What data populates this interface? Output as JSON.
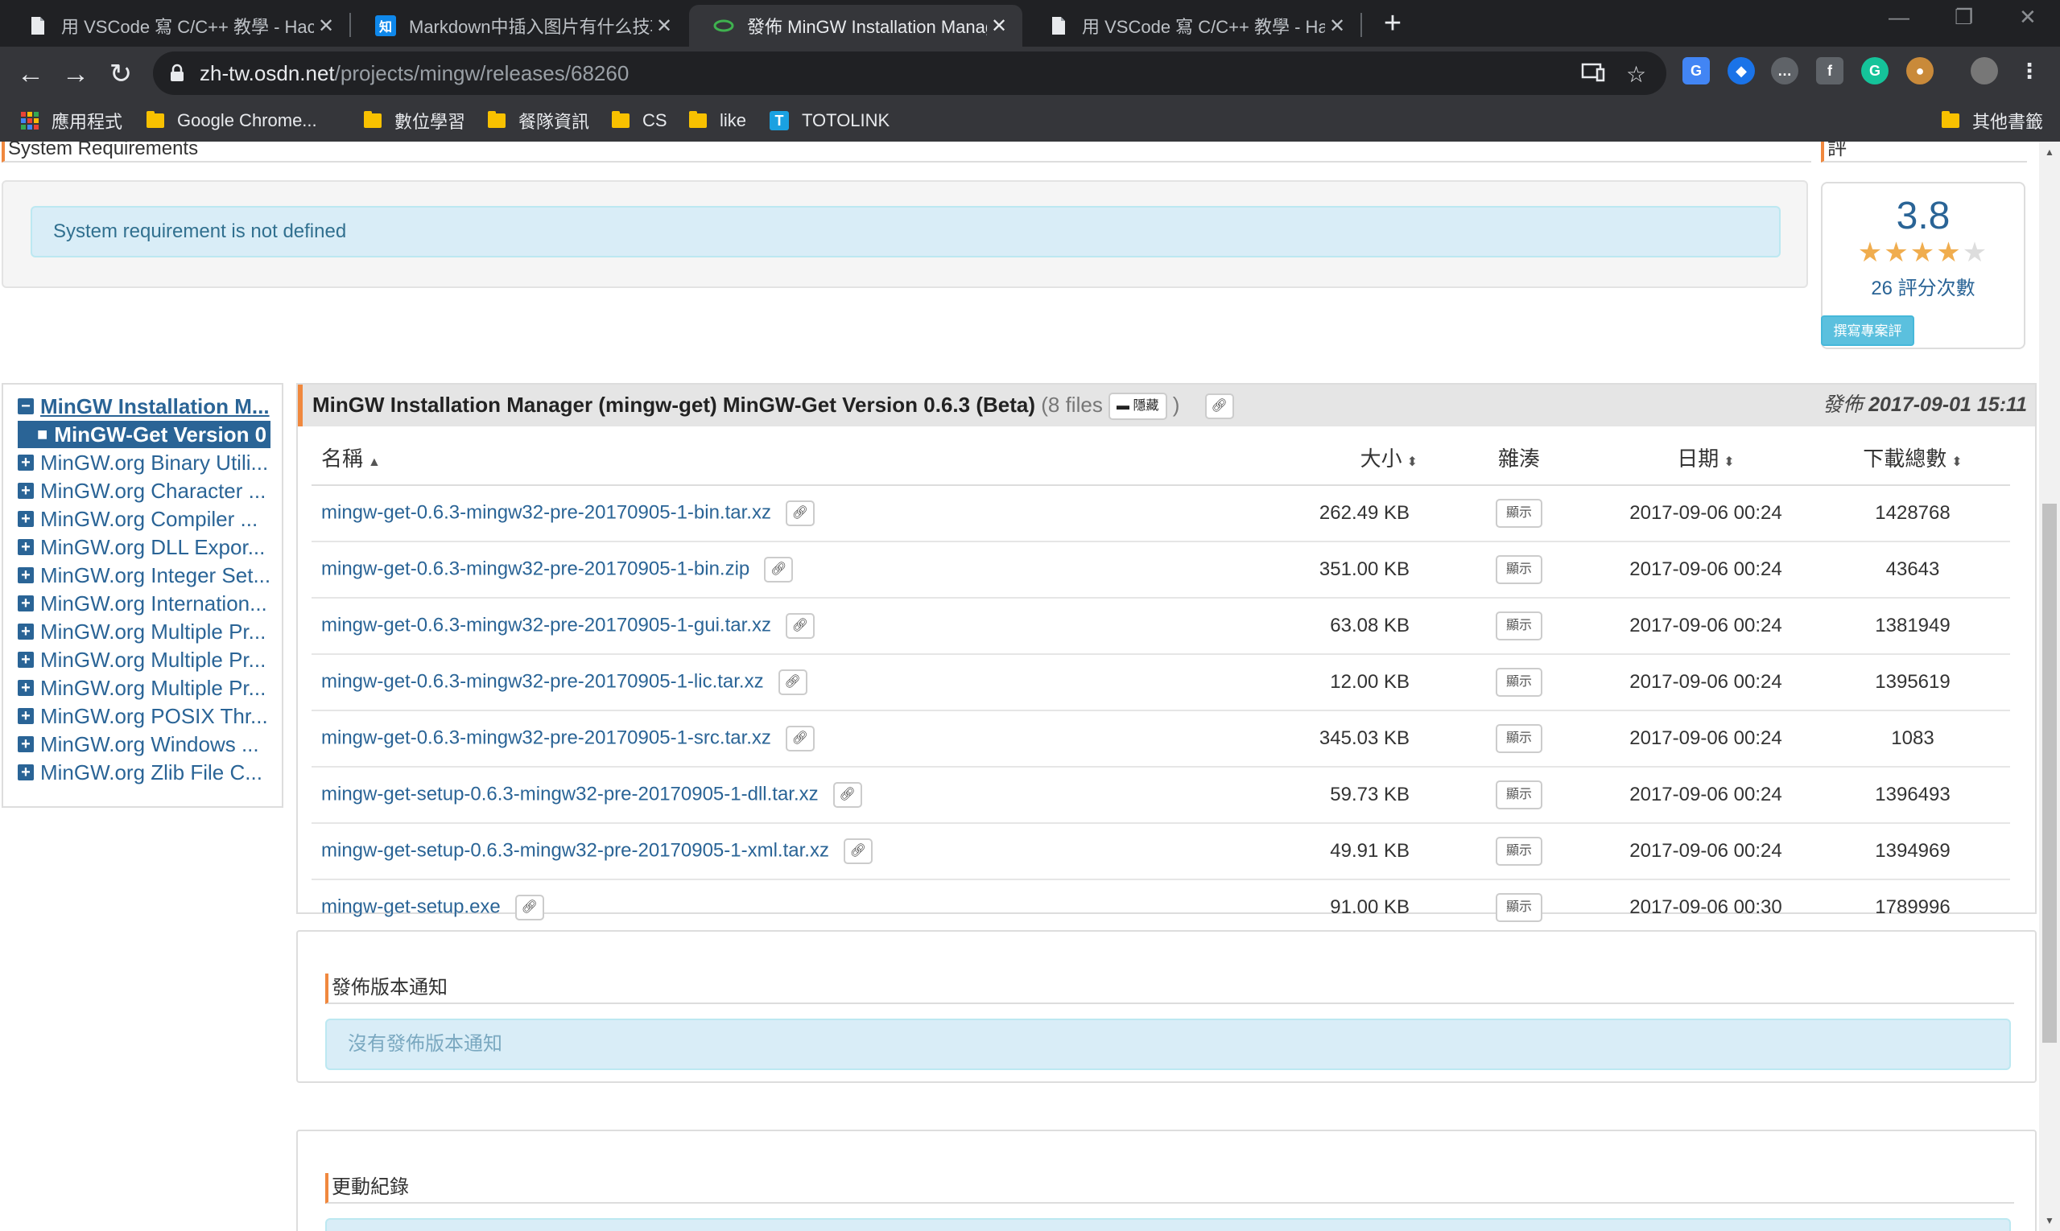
{
  "browser": {
    "tabs": [
      {
        "title": "用 VSCode 寫 C/C++ 教學 - Hac",
        "favicon": "doc-icon",
        "active": false
      },
      {
        "title": "Markdown中插入图片有什么技巧",
        "favicon": "zhihu-icon",
        "favicon_text": "知",
        "active": false
      },
      {
        "title": "發佈 MinGW Installation Manag",
        "favicon": "osdn-icon",
        "active": true
      },
      {
        "title": "用 VSCode 寫 C/C++ 教學 - Hac",
        "favicon": "doc-icon",
        "active": false
      }
    ],
    "new_tab_label": "+",
    "url_host": "zh-tw.osdn.net",
    "url_path": "/projects/mingw/releases/68260",
    "bookmarks": [
      {
        "label": "應用程式",
        "icon": "apps-icon"
      },
      {
        "label": "Google Chrome...",
        "icon": "folder-icon"
      },
      {
        "label": "數位學習",
        "icon": "folder-icon"
      },
      {
        "label": "餐隊資訊",
        "icon": "folder-icon"
      },
      {
        "label": "CS",
        "icon": "folder-icon"
      },
      {
        "label": "like",
        "icon": "folder-icon"
      },
      {
        "label": "TOTOLINK",
        "icon": "totolink-icon"
      }
    ],
    "other_bookmarks": "其他書籤",
    "colors": {
      "tabstrip": "#202124",
      "toolbar": "#35363a",
      "folder": "#f8c100"
    }
  },
  "page": {
    "sysreq": {
      "heading": "System Requirements",
      "message": "System requirement is not defined"
    },
    "rating": {
      "heading": "評",
      "score": "3.8",
      "stars_filled": 4,
      "stars_total": 5,
      "count_text": "26 評分次數",
      "write_review_label": "撰寫專案評"
    },
    "tree": {
      "items": [
        {
          "label": "MinGW Installation M...",
          "state": "expanded"
        },
        {
          "label": "MinGW-Get Version 0",
          "state": "selected"
        },
        {
          "label": "MinGW.org Binary Utili...",
          "state": "collapsed"
        },
        {
          "label": "MinGW.org Character ...",
          "state": "collapsed"
        },
        {
          "label": "MinGW.org Compiler ...",
          "state": "collapsed"
        },
        {
          "label": "MinGW.org DLL Expor...",
          "state": "collapsed"
        },
        {
          "label": "MinGW.org Integer Set...",
          "state": "collapsed"
        },
        {
          "label": "MinGW.org Internation...",
          "state": "collapsed"
        },
        {
          "label": "MinGW.org Multiple Pr...",
          "state": "collapsed"
        },
        {
          "label": "MinGW.org Multiple Pr...",
          "state": "collapsed"
        },
        {
          "label": "MinGW.org Multiple Pr...",
          "state": "collapsed"
        },
        {
          "label": "MinGW.org POSIX Thr...",
          "state": "collapsed"
        },
        {
          "label": "MinGW.org Windows ...",
          "state": "collapsed"
        },
        {
          "label": "MinGW.org Zlib File C...",
          "state": "collapsed"
        }
      ]
    },
    "release": {
      "title": "MinGW Installation Manager (mingw-get) MinGW-Get Version 0.6.3 (Beta)",
      "files_open": "(8 files",
      "hide_label": "隱藏",
      "files_close": ")",
      "published_label": "發佈",
      "published_date": "2017-09-01 15:11",
      "columns": {
        "name": "名稱",
        "size": "大小",
        "hash": "雜湊",
        "date": "日期",
        "downloads": "下載總數"
      },
      "show_label": "顯示",
      "files": [
        {
          "name": "mingw-get-0.6.3-mingw32-pre-20170905-1-bin.tar.xz",
          "size": "262.49 KB",
          "date": "2017-09-06 00:24",
          "downloads": "1428768"
        },
        {
          "name": "mingw-get-0.6.3-mingw32-pre-20170905-1-bin.zip",
          "size": "351.00 KB",
          "date": "2017-09-06 00:24",
          "downloads": "43643"
        },
        {
          "name": "mingw-get-0.6.3-mingw32-pre-20170905-1-gui.tar.xz",
          "size": "63.08 KB",
          "date": "2017-09-06 00:24",
          "downloads": "1381949"
        },
        {
          "name": "mingw-get-0.6.3-mingw32-pre-20170905-1-lic.tar.xz",
          "size": "12.00 KB",
          "date": "2017-09-06 00:24",
          "downloads": "1395619"
        },
        {
          "name": "mingw-get-0.6.3-mingw32-pre-20170905-1-src.tar.xz",
          "size": "345.03 KB",
          "date": "2017-09-06 00:24",
          "downloads": "1083"
        },
        {
          "name": "mingw-get-setup-0.6.3-mingw32-pre-20170905-1-dll.tar.xz",
          "size": "59.73 KB",
          "date": "2017-09-06 00:24",
          "downloads": "1396493"
        },
        {
          "name": "mingw-get-setup-0.6.3-mingw32-pre-20170905-1-xml.tar.xz",
          "size": "49.91 KB",
          "date": "2017-09-06 00:24",
          "downloads": "1394969"
        },
        {
          "name": "mingw-get-setup.exe",
          "size": "91.00 KB",
          "date": "2017-09-06 00:30",
          "downloads": "1789996"
        }
      ]
    },
    "release_notes": {
      "heading": "發佈版本通知",
      "message": "沒有發佈版本通知"
    },
    "changelog": {
      "heading": "更動紀錄"
    },
    "colors": {
      "accent": "#f0883e",
      "link": "#2a6496",
      "alert_bg": "#d9edf7",
      "star": "#f0ad4e"
    }
  }
}
